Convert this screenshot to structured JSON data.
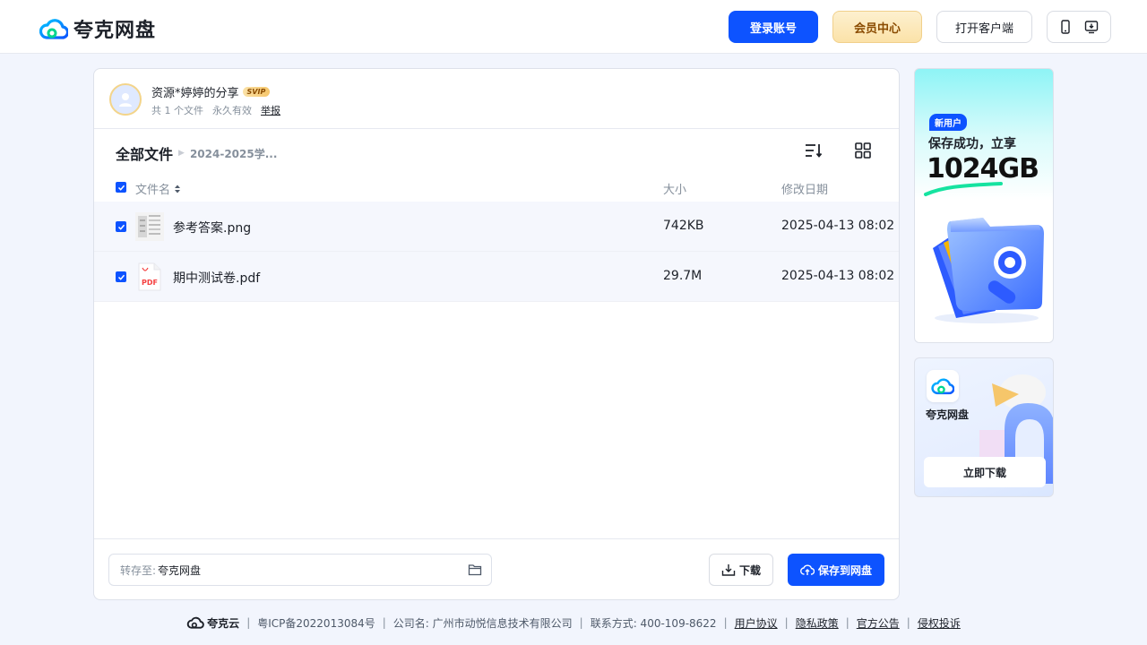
{
  "header": {
    "logo_text": "夸克网盘",
    "login_label": "登录账号",
    "vip_label": "会员中心",
    "client_label": "打开客户端"
  },
  "share": {
    "title": "资源*婷婷的分享",
    "badge": "SVIP",
    "file_count": "共 1 个文件",
    "validity": "永久有效",
    "report_label": "举报"
  },
  "breadcrumb": {
    "root": "全部文件",
    "current": "2024-2025学..."
  },
  "table": {
    "columns": {
      "name": "文件名",
      "size": "大小",
      "date": "修改日期"
    },
    "rows": [
      {
        "name": "参考答案.png",
        "size": "742KB",
        "date": "2025-04-13 08:02",
        "type": "image",
        "checked": true
      },
      {
        "name": "期中测试卷.pdf",
        "size": "29.7M",
        "date": "2025-04-13 08:02",
        "type": "pdf",
        "checked": true,
        "type_label": "PDF"
      }
    ]
  },
  "actions": {
    "save_to_label": "转存至:",
    "save_to_value": "夸克网盘",
    "download_label": "下载",
    "save_label": "保存到网盘"
  },
  "ad_new_user": {
    "tag": "新用户",
    "line1": "保存成功，立享",
    "line2": "1024GB"
  },
  "ad_app": {
    "name": "夸克网盘",
    "download_label": "立即下载"
  },
  "footer": {
    "brand": "夸克云",
    "icp": "粤ICP备2022013084号",
    "company": "公司名: 广州市动悦信息技术有限公司",
    "contact": "联系方式: 400-109-8622",
    "links": [
      "用户协议",
      "隐私政策",
      "官方公告",
      "侵权投诉"
    ]
  },
  "colors": {
    "accent": "#0d53ff",
    "vip_text": "#8a4b00",
    "page_bg": "#f2f5fd"
  }
}
